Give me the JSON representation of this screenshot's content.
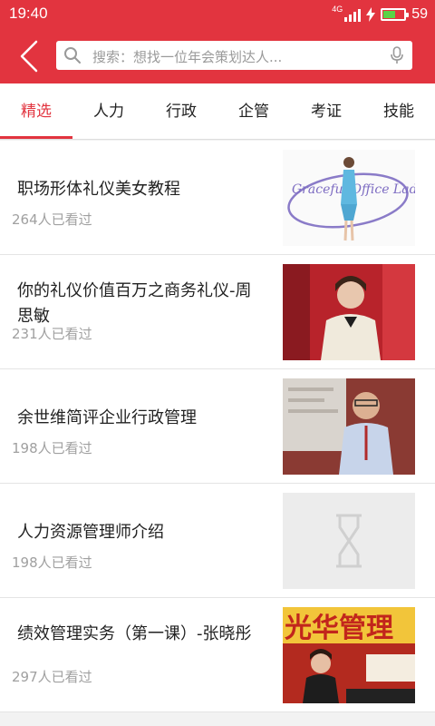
{
  "status_bar": {
    "time": "19:40",
    "network": "4G",
    "battery_level": "59",
    "battery_fraction": 0.59
  },
  "search": {
    "placeholder": "搜索：想找一位年会策划达人..."
  },
  "tabs": [
    {
      "label": "精选",
      "active": true
    },
    {
      "label": "人力",
      "active": false
    },
    {
      "label": "行政",
      "active": false
    },
    {
      "label": "企管",
      "active": false
    },
    {
      "label": "考证",
      "active": false
    },
    {
      "label": "技能",
      "active": false
    }
  ],
  "courses": [
    {
      "title": "职场形体礼仪美女教程",
      "views": "264人已看过",
      "thumbnail": "graceful-office-lady-image",
      "thumbnail_text": "Graceful Office Lady"
    },
    {
      "title": "你的礼仪价值百万之商务礼仪-周思敏",
      "views": "231人已看过",
      "thumbnail": "etiquette-lecturer-image"
    },
    {
      "title": "余世维简评企业行政管理",
      "views": "198人已看过",
      "thumbnail": "lecturer-presenting-image"
    },
    {
      "title": "人力资源管理师介绍",
      "views": "198人已看过",
      "thumbnail": "loading-placeholder-image"
    },
    {
      "title": "绩效管理实务（第一课）-张晓彤",
      "views": "297人已看过",
      "thumbnail": "management-banner-image",
      "thumbnail_text": "光华管理"
    }
  ],
  "colors": {
    "brand": "#e2343f",
    "views_text": "#a0a0a0"
  }
}
